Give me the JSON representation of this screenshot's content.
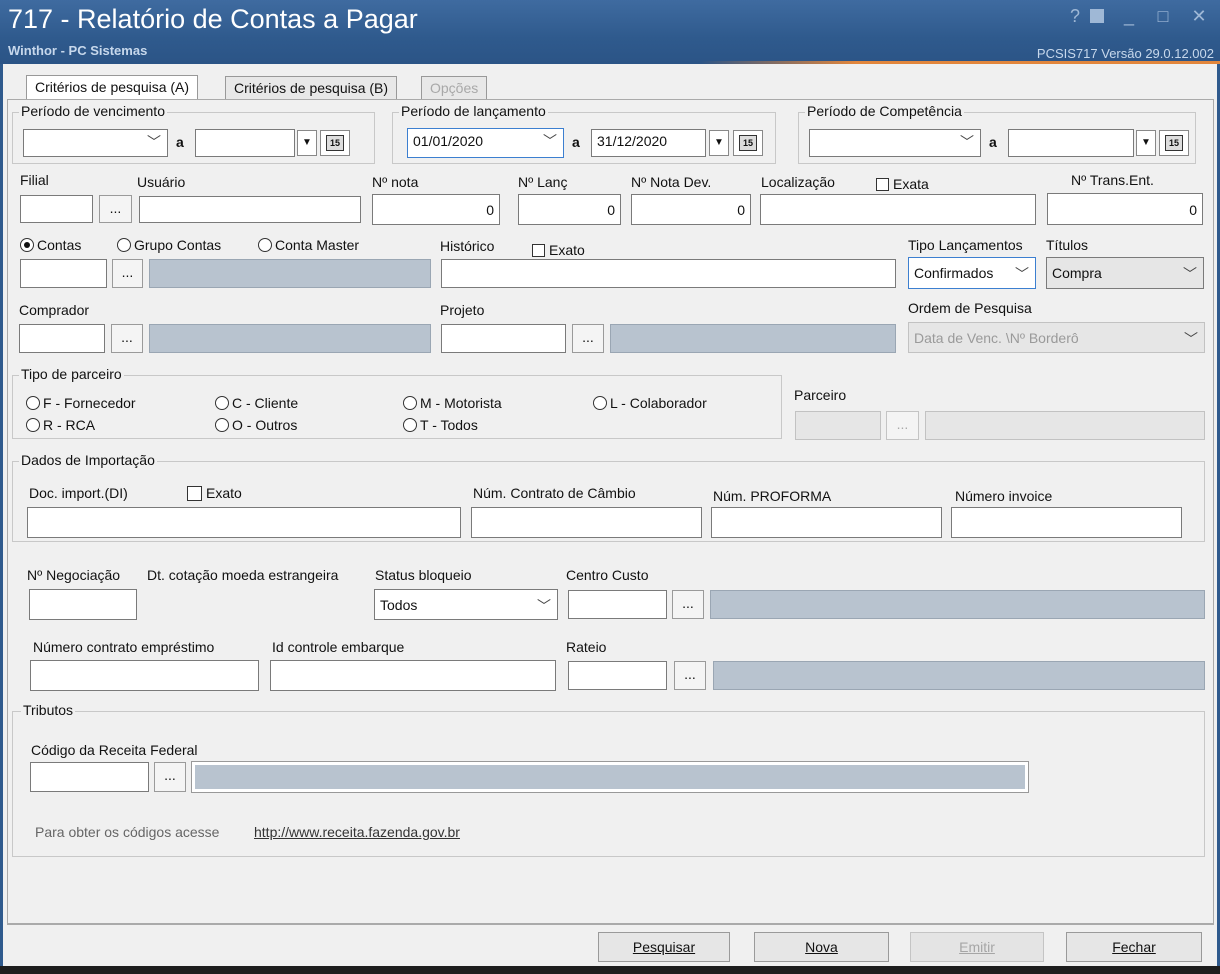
{
  "window": {
    "title": "717 - Relatório de Contas a Pagar",
    "subtitle": "Winthor - PC Sistemas",
    "version": "PCSIS717  Versão  29.0.12.002",
    "controls": {
      "help": "?",
      "min": "_",
      "max": "□",
      "close": "✕"
    }
  },
  "tabs": [
    {
      "label": "Critérios de pesquisa (A)",
      "state": "active"
    },
    {
      "label": "Critérios de pesquisa (B)",
      "state": "normal"
    },
    {
      "label": "Opções",
      "state": "disabled"
    }
  ],
  "periodo_vencimento": {
    "label": "Período de vencimento",
    "from": "",
    "sep": "a",
    "to": ""
  },
  "periodo_lancamento": {
    "label": "Período de lançamento",
    "from": "01/01/2020",
    "sep": "a",
    "to": "31/12/2020"
  },
  "periodo_competencia": {
    "label": "Período de Competência",
    "from": "",
    "sep": "a",
    "to": ""
  },
  "calendar_icon_text": "15",
  "ellipsis": "...",
  "row2": {
    "filial": "Filial",
    "usuario": "Usuário",
    "nota": "Nº nota",
    "nota_value": "0",
    "lanc": "Nº Lanç",
    "lanc_value": "0",
    "nota_dev": "Nº Nota Dev.",
    "nota_dev_value": "0",
    "localizacao": "Localização",
    "exata": "Exata",
    "trans": "Nº Trans.Ent.",
    "trans_value": "0"
  },
  "row3": {
    "radio_contas": "Contas",
    "radio_grupo": "Grupo Contas",
    "radio_master": "Conta Master",
    "historico": "Histórico",
    "exato": "Exato",
    "tipo_lanc_label": "Tipo Lançamentos",
    "tipo_lanc_value": "Confirmados",
    "titulos_label": "Títulos",
    "titulos_value": "Compra"
  },
  "row4": {
    "comprador": "Comprador",
    "projeto": "Projeto",
    "ordem_label": "Ordem de Pesquisa",
    "ordem_value": "Data de Venc. \\Nº Borderô"
  },
  "tipo_parceiro": {
    "label": "Tipo de parceiro",
    "options": [
      "F - Fornecedor",
      "C - Cliente",
      "M - Motorista",
      "L - Colaborador",
      "R - RCA",
      "O - Outros",
      "T - Todos"
    ],
    "parceiro": "Parceiro"
  },
  "importacao": {
    "label": "Dados de Importação",
    "doc": "Doc. import.(DI)",
    "exato": "Exato",
    "contrato": "Núm. Contrato de Câmbio",
    "proforma": "Núm. PROFORMA",
    "invoice": "Número invoice"
  },
  "row7": {
    "negociacao": "Nº Negociação",
    "cotacao": "Dt. cotação moeda estrangeira",
    "status_label": "Status bloqueio",
    "status_value": "Todos",
    "centro": "Centro Custo"
  },
  "row8": {
    "emprestimo": "Número contrato empréstimo",
    "embarque": "Id controle embarque",
    "rateio": "Rateio"
  },
  "tributos": {
    "label": "Tributos",
    "receita": "Código da Receita Federal",
    "hint": "Para obter os códigos acesse",
    "link": "http://www.receita.fazenda.gov.br"
  },
  "buttons": {
    "pesquisar": "Pesquisar",
    "nova": "Nova",
    "emitir": "Emitir",
    "fechar": "Fechar"
  }
}
